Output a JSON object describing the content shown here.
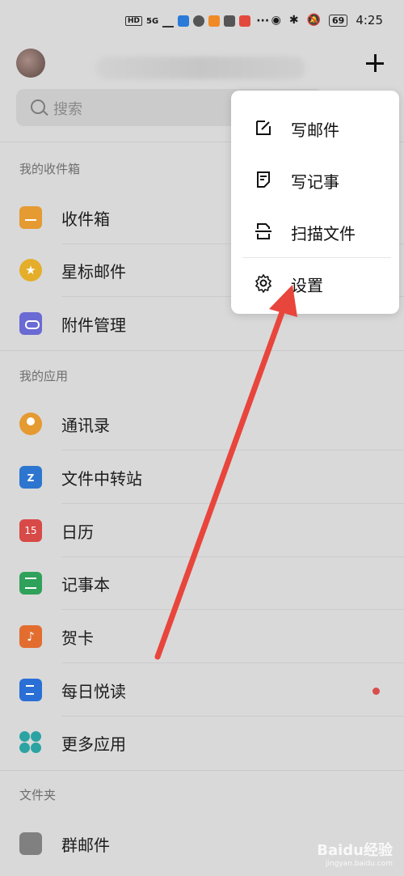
{
  "status_bar": {
    "indicators": [
      "HD",
      "5G"
    ],
    "battery": "69",
    "time": "4:25"
  },
  "header": {
    "plus_icon": "plus-icon"
  },
  "search": {
    "placeholder": "搜索"
  },
  "sections": {
    "mailbox": {
      "title": "我的收件箱",
      "items": [
        {
          "label": "收件箱",
          "icon": "inbox-icon"
        },
        {
          "label": "星标邮件",
          "icon": "star-icon"
        },
        {
          "label": "附件管理",
          "icon": "attachment-icon"
        }
      ]
    },
    "apps": {
      "title": "我的应用",
      "items": [
        {
          "label": "通讯录",
          "icon": "contacts-icon"
        },
        {
          "label": "文件中转站",
          "icon": "folder-z-icon",
          "glyph": "Z"
        },
        {
          "label": "日历",
          "icon": "calendar-icon",
          "glyph": "15"
        },
        {
          "label": "记事本",
          "icon": "notebook-icon"
        },
        {
          "label": "贺卡",
          "icon": "music-card-icon",
          "glyph": "♪"
        },
        {
          "label": "每日悦读",
          "icon": "reading-icon"
        },
        {
          "label": "更多应用",
          "icon": "more-apps-icon"
        }
      ]
    },
    "folders": {
      "title": "文件夹",
      "items": [
        {
          "label": "群邮件",
          "icon": "group-folder-icon"
        }
      ]
    }
  },
  "menu": {
    "items": [
      {
        "label": "写邮件",
        "icon": "compose-icon"
      },
      {
        "label": "写记事",
        "icon": "write-note-icon"
      },
      {
        "label": "扫描文件",
        "icon": "scan-icon"
      },
      {
        "label": "设置",
        "icon": "gear-icon"
      }
    ]
  },
  "watermark": {
    "brand": "Baidu经验",
    "url": "jingyan.baidu.com"
  },
  "colors": {
    "arrow": "#e8453c",
    "background": "#d9d9d9"
  }
}
